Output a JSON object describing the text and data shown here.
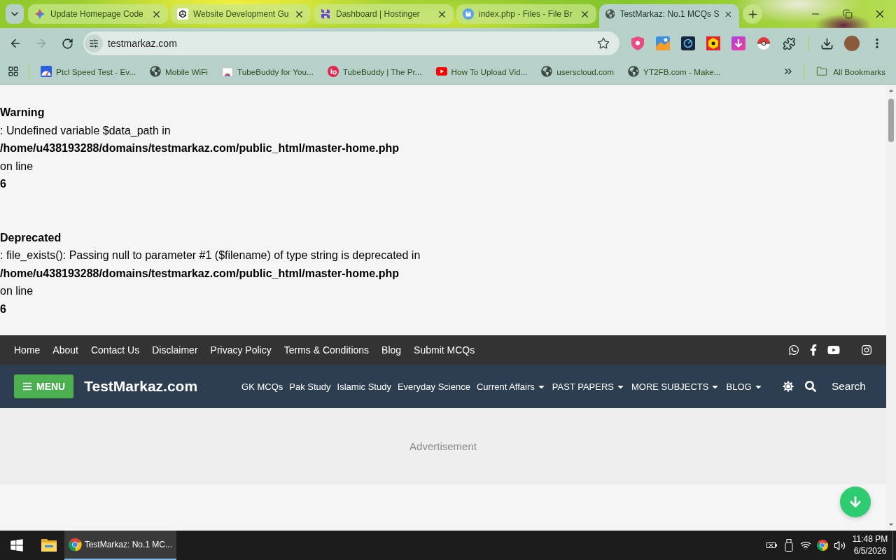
{
  "tab_strip": {
    "tabs": [
      {
        "title": "Update Homepage Code",
        "selected": false
      },
      {
        "title": "Website Development Gu",
        "selected": false
      },
      {
        "title": "Dashboard | Hostinger",
        "selected": false
      },
      {
        "title": "index.php - Files - File Br",
        "selected": false
      },
      {
        "title": "TestMarkaz: No.1 MCQs S",
        "selected": true
      }
    ]
  },
  "toolbar": {
    "nav_buttons": [
      {
        "kind": "back",
        "disabled": false
      },
      {
        "kind": "forward",
        "disabled": true
      },
      {
        "kind": "reload",
        "disabled": false
      }
    ],
    "address": {
      "value": "testmarkaz.com"
    }
  },
  "bookmarks_bar": {
    "items": [
      {
        "title": "Ptcl Speed Test - Ev..."
      },
      {
        "title": "Mobile WiFi"
      },
      {
        "title": "TubeBuddy for You..."
      },
      {
        "title": "TubeBuddy | The Pr..."
      },
      {
        "title": "How To Upload Vid..."
      },
      {
        "title": "userscloud.com"
      },
      {
        "title": "YT2FB.com - Make..."
      }
    ],
    "all_bookmarks": "All Bookmarks"
  },
  "page": {
    "errors": [
      {
        "severity": "Warning",
        "message": ": Undefined variable $data_path in",
        "file": "/home/u438193288/domains/testmarkaz.com/public_html/master-home.php",
        "line_label": "on line",
        "line": "6"
      },
      {
        "severity": "Deprecated",
        "message": ": file_exists(): Passing null to parameter #1 ($filename) of type string is deprecated in",
        "file": "/home/u438193288/domains/testmarkaz.com/public_html/master-home.php",
        "line_label": "on line",
        "line": "6"
      }
    ],
    "top_bar": {
      "links": [
        "Home",
        "About",
        "Contact Us",
        "Disclaimer",
        "Privacy Policy",
        "Terms & Conditions",
        "Blog",
        "Submit MCQs"
      ]
    },
    "main_nav": {
      "menu_button": "MENU",
      "logo": "TestMarkaz.com",
      "links": [
        {
          "label": "GK MCQs",
          "dropdown": false
        },
        {
          "label": "Pak Study",
          "dropdown": false
        },
        {
          "label": "Islamic Study",
          "dropdown": false
        },
        {
          "label": "Everyday Science",
          "dropdown": false
        },
        {
          "label": "Current Affairs",
          "dropdown": true
        },
        {
          "label": "PAST PAPERS",
          "dropdown": true
        },
        {
          "label": "MORE SUBJECTS",
          "dropdown": true
        },
        {
          "label": "BLOG",
          "dropdown": true
        }
      ],
      "search_label": "Search"
    },
    "advertisement": "Advertisement"
  },
  "taskbar": {
    "apps": [
      {
        "title": "TestMarkaz: No.1 MC...",
        "selected": true
      }
    ],
    "time": "11:48 PM",
    "date": "6/5/2026"
  }
}
